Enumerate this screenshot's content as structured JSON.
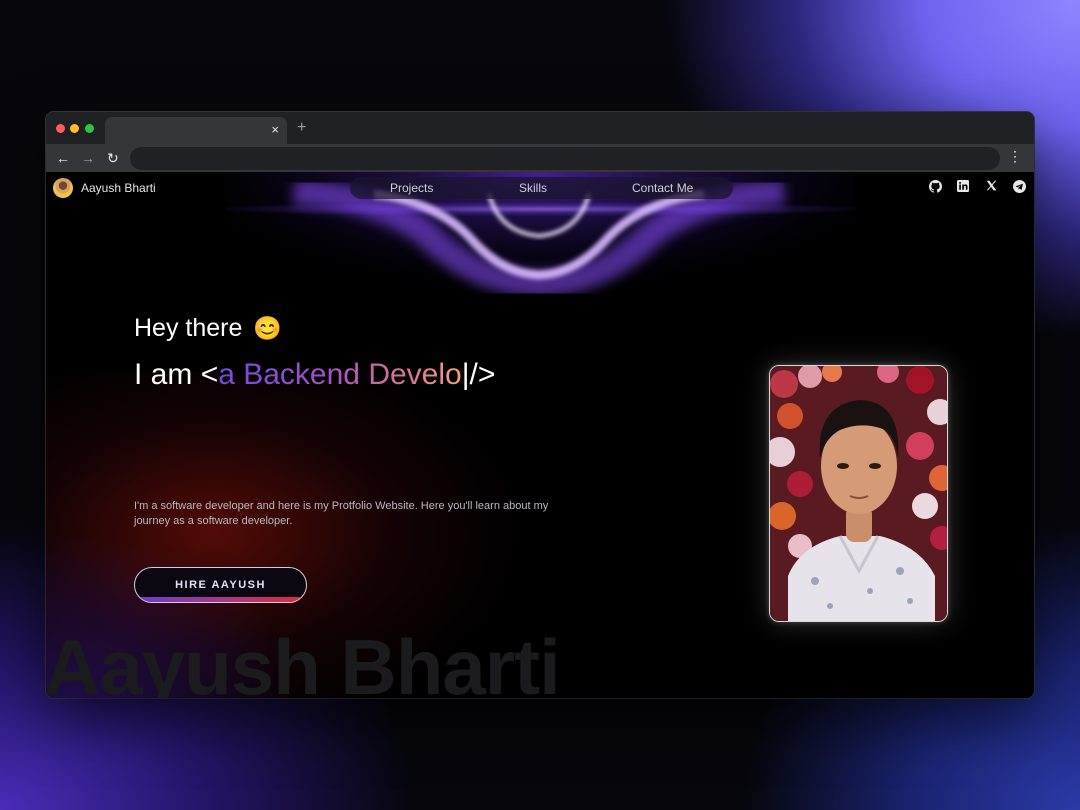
{
  "browser": {
    "tab_close": "×",
    "new_tab": "+",
    "back": "←",
    "forward": "→",
    "reload": "↻",
    "menu": "⋮"
  },
  "header": {
    "brand": "Aayush Bharti",
    "nav": [
      "Projects",
      "Skills",
      "Contact Me"
    ],
    "social_icons": [
      "github-icon",
      "linkedin-icon",
      "x-icon",
      "telegram-icon"
    ]
  },
  "hero": {
    "greeting": "Hey there",
    "greeting_emoji": "😊",
    "intro_prefix": "I am ",
    "intro_open": "<",
    "intro_role": "a Backend Develo",
    "intro_cursor": "|",
    "intro_close": "/>",
    "description": "I'm a software developer and here is my Protfolio Website. Here you'll learn about my journey as a software developer.",
    "cta": "HIRE AAYUSH"
  },
  "watermark": "Aayush Bharti",
  "colors": {
    "accent_start": "#6f4ae0",
    "accent_mid": "#a353c9",
    "accent_end": "#f2a080",
    "cta_bar_end": "#e02a3a"
  }
}
